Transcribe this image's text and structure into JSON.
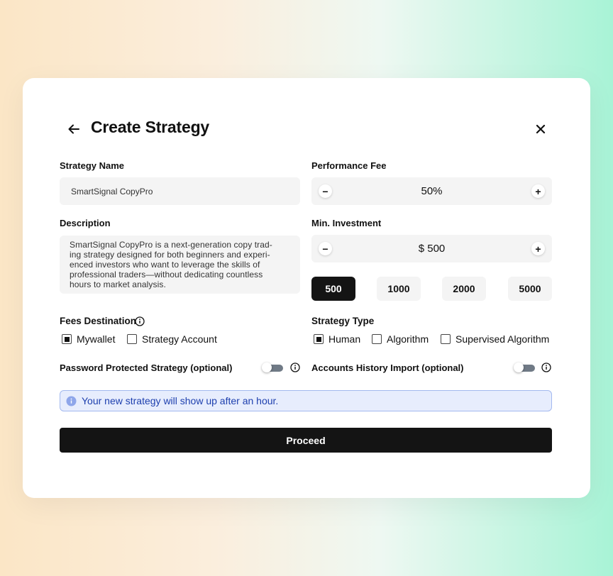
{
  "header": {
    "title": "Create Strategy"
  },
  "strategy_name": {
    "label": "Strategy Name",
    "value": "SmartSignal CopyPro"
  },
  "description": {
    "label": "Description",
    "lines": [
      "SmartSignal CopyPro is a next-generation copy trad-",
      "ing strategy designed for both beginners and experi-",
      "enced investors who want to leverage the skills of",
      "professional traders—without dedicating countless",
      "hours to market analysis."
    ]
  },
  "performance_fee": {
    "label": "Performance Fee",
    "value": "50%",
    "minus": "−",
    "plus": "+"
  },
  "min_investment": {
    "label": "Min. Investment",
    "value": "$ 500",
    "minus": "−",
    "plus": "+",
    "presets": [
      "500",
      "1000",
      "2000",
      "5000"
    ],
    "selected_preset": "500"
  },
  "fees_destination": {
    "label": "Fees Destination",
    "options": [
      {
        "label": "Mywallet",
        "checked": true
      },
      {
        "label": "Strategy Account",
        "checked": false
      }
    ]
  },
  "strategy_type": {
    "label": "Strategy Type",
    "options": [
      {
        "label": "Human",
        "checked": true
      },
      {
        "label": "Algorithm",
        "checked": false
      },
      {
        "label": "Supervised Algorithm",
        "checked": false
      }
    ]
  },
  "password_protected": {
    "label": "Password Protected Strategy (optional)",
    "enabled": false
  },
  "history_import": {
    "label": "Accounts History Import (optional)",
    "enabled": false
  },
  "notice": {
    "text": "Your new strategy will show up after an hour.",
    "color": "#1d3fae",
    "background": "#e7edfd"
  },
  "proceed": {
    "label": "Proceed"
  },
  "colors": {
    "primary": "#141414",
    "field": "#f4f4f4",
    "info": "#1d3fae"
  }
}
